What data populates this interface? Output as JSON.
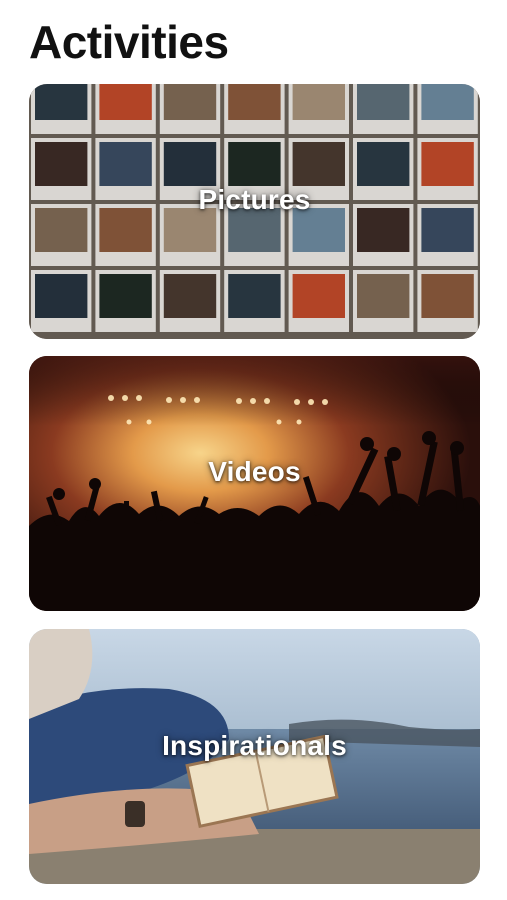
{
  "header": {
    "title": "Activities"
  },
  "cards": [
    {
      "label": "Pictures",
      "image": "polaroid-photo-wall"
    },
    {
      "label": "Videos",
      "image": "concert-crowd"
    },
    {
      "label": "Inspirationals",
      "image": "person-reading-book-by-water"
    }
  ]
}
